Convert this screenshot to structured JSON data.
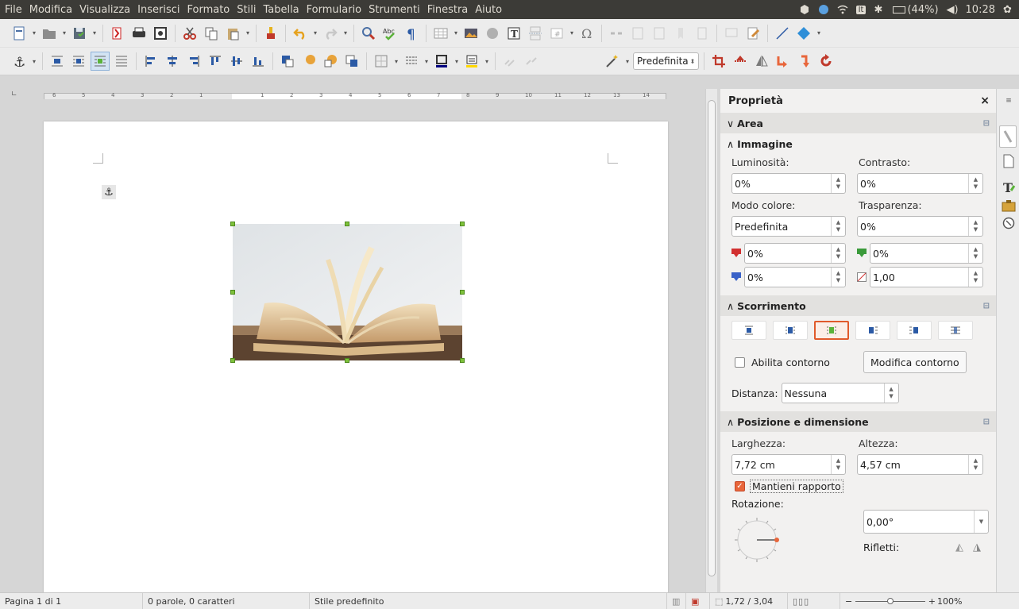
{
  "menu": [
    "File",
    "Modifica",
    "Visualizza",
    "Inserisci",
    "Formato",
    "Stili",
    "Tabella",
    "Formulario",
    "Strumenti",
    "Finestra",
    "Aiuto"
  ],
  "tray": {
    "keyboard_layout": "It",
    "battery": "(44%)",
    "clock": "10:28"
  },
  "toolbar2": {
    "frame_style": "Predefinita"
  },
  "ruler": {
    "left_labels": [
      "6",
      "5",
      "4",
      "3",
      "2",
      "1"
    ],
    "right_labels": [
      "1",
      "2",
      "3",
      "4",
      "5",
      "6",
      "7",
      "8",
      "9",
      "10",
      "11",
      "12",
      "13",
      "14"
    ]
  },
  "sidebar": {
    "title": "Proprietà",
    "close_label": "×",
    "area": {
      "title": "Area"
    },
    "image": {
      "title": "Immagine",
      "brightness_label": "Luminosità:",
      "brightness_value": "0%",
      "contrast_label": "Contrasto:",
      "contrast_value": "0%",
      "color_mode_label": "Modo colore:",
      "color_mode_value": "Predefinita",
      "transparency_label": "Trasparenza:",
      "transparency_value": "0%",
      "red_value": "0%",
      "green_value": "0%",
      "blue_value": "0%",
      "gamma_value": "1,00"
    },
    "wrap": {
      "title": "Scorrimento",
      "contour_label": "Abilita contorno",
      "edit_contour_label": "Modifica contorno",
      "distance_label": "Distanza:",
      "distance_value": "Nessuna"
    },
    "position": {
      "title": "Posizione e dimensione",
      "width_label": "Larghezza:",
      "width_value": "7,72 cm",
      "height_label": "Altezza:",
      "height_value": "4,57 cm",
      "keep_ratio_label": "Mantieni rapporto",
      "rotation_label": "Rotazione:",
      "rotation_value": "0,00°",
      "flip_label": "Rifletti:"
    }
  },
  "status": {
    "page": "Pagina 1 di 1",
    "words": "0 parole, 0 caratteri",
    "page_style": "Stile predefinito",
    "position": "1,72 / 3,04",
    "zoom": "100%"
  },
  "colors": {
    "accent": "#e05a2b",
    "handle": "#7dc13a",
    "menubar": "#3c3b37"
  }
}
